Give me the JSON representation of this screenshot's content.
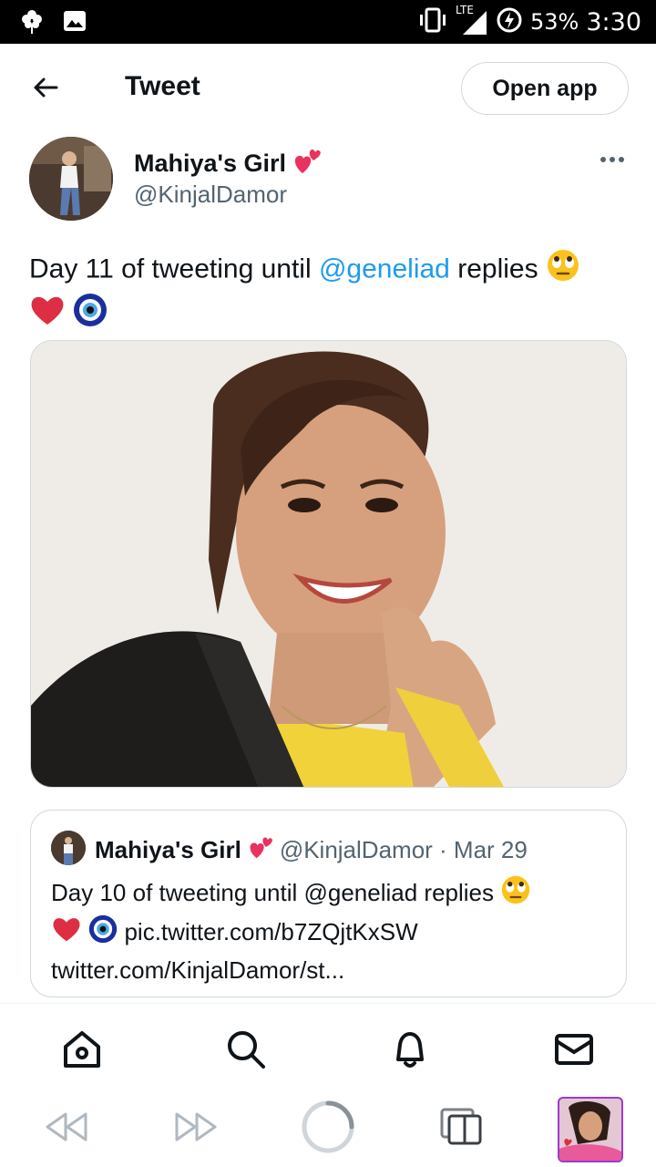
{
  "status_bar": {
    "lte": "LTE",
    "battery": "53%",
    "time": "3:30"
  },
  "header": {
    "title": "Tweet",
    "open_app_label": "Open app"
  },
  "tweet": {
    "author_name": "Mahiya's Girl",
    "author_handle": "@KinjalDamor",
    "text_before": "Day 11 of tweeting until ",
    "mention": "@geneliad",
    "text_after": " replies"
  },
  "quoted_tweet": {
    "author_name": "Mahiya's Girl",
    "meta": "@KinjalDamor · Mar 29",
    "line1": "Day 10 of tweeting until @geneliad replies",
    "line2_link": "pic.twitter.com/b7ZQjtKxSW",
    "line3": "twitter.com/KinjalDamor/st..."
  },
  "colors": {
    "accent": "#1d9bf0",
    "text": "#0f1419",
    "secondary": "#536471",
    "border": "#cfd9de"
  },
  "icons": [
    "back-arrow-icon",
    "more-icon",
    "two-hearts-emoji",
    "rolling-eyes-emoji",
    "red-heart-emoji",
    "nazar-amulet-emoji",
    "home-icon",
    "search-icon",
    "bell-icon",
    "mail-icon",
    "rewind-icon",
    "forward-icon",
    "loading-icon",
    "tabs-icon"
  ]
}
